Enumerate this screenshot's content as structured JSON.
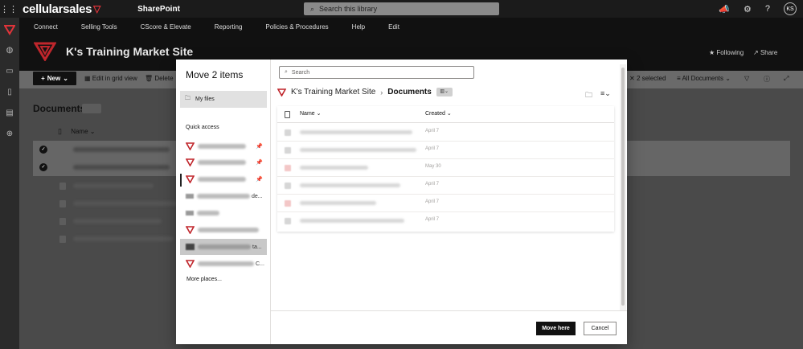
{
  "suite": {
    "brand": "cellularsales",
    "app_name": "SharePoint",
    "search_placeholder": "Search this library",
    "avatar_initials": "KS"
  },
  "site": {
    "nav": [
      "Connect",
      "Selling Tools",
      "CScore & Elevate",
      "Reporting",
      "Policies & Procedures",
      "Help",
      "Edit"
    ],
    "title": "K's Training Market Site",
    "following_label": "Following",
    "share_label": "Share"
  },
  "command_bar": {
    "new_label": "New",
    "grid_label": "Edit in grid view",
    "delete_label": "Delete",
    "selected_label": "2 selected",
    "all_documents_label": "All Documents"
  },
  "library": {
    "title": "Documents",
    "name_column": "Name"
  },
  "dialog": {
    "title": "Move 2 items",
    "my_files_label": "My files",
    "quick_access_label": "Quick access",
    "quick_access_suffixes": [
      "de...",
      "ta...",
      "C..."
    ],
    "more_places_label": "More places...",
    "search_placeholder": "Search",
    "breadcrumb": {
      "site": "K's Training Market Site",
      "current": "Documents"
    },
    "columns": {
      "name": "Name",
      "created": "Created"
    },
    "rows": [
      {
        "created": "April 7",
        "type": "doc"
      },
      {
        "created": "April 7",
        "type": "doc"
      },
      {
        "created": "May 30",
        "type": "pdf"
      },
      {
        "created": "April 7",
        "type": "doc"
      },
      {
        "created": "April 7",
        "type": "pdf"
      },
      {
        "created": "April 7",
        "type": "doc"
      }
    ],
    "move_button": "Move here",
    "cancel_button": "Cancel"
  },
  "colors": {
    "brand_red": "#e0343a",
    "primary_button": "#111111"
  }
}
